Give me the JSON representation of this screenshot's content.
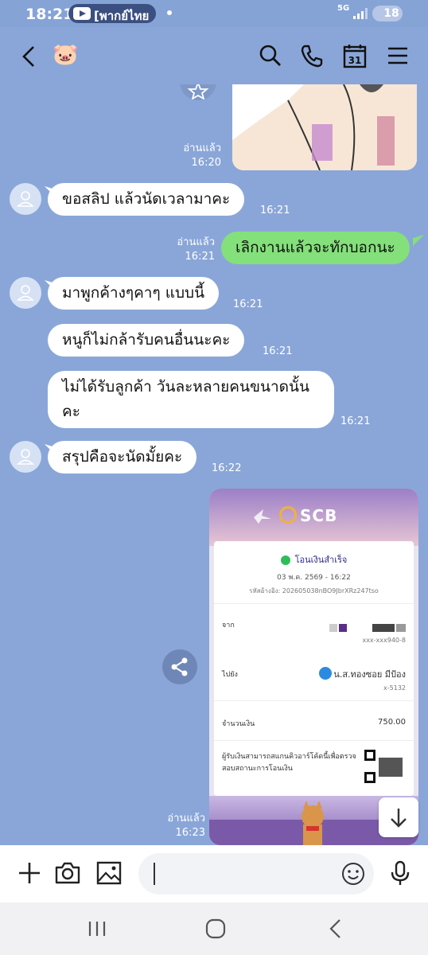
{
  "status_bar": {
    "time": "18:21",
    "pill_text": "[พากย์ไทย",
    "network": "5G",
    "battery": "18"
  },
  "header": {
    "contact_emoji": "🐷",
    "icons": [
      "back-icon",
      "search-icon",
      "call-icon",
      "calendar-icon",
      "menu-icon"
    ],
    "calendar_day": "31"
  },
  "chat": {
    "sticker_meta": {
      "read": "อ่านแล้ว",
      "time": "16:20"
    },
    "messages": [
      {
        "side": "in",
        "text": "ขอสลิป แล้วนัดเวลามาคะ",
        "time": "16:21"
      },
      {
        "side": "out",
        "read": "อ่านแล้ว",
        "text": "เลิกงานแล้วจะทักบอกนะ",
        "time": "16:21"
      },
      {
        "side": "in",
        "text": "มาพูกค้างๆคาๆ แบบนี้",
        "time": "16:21"
      },
      {
        "side": "in",
        "text": "หนูก็ไม่กล้ารับคนอื่นนะคะ",
        "time": "16:21"
      },
      {
        "side": "in",
        "text": "ไม่ได้รับลูกค้า วันละหลายคนขนาดนั้นคะ",
        "time": "16:21"
      },
      {
        "side": "in",
        "text": "สรุปคือจะนัดมั้ยคะ",
        "time": "16:22"
      }
    ],
    "slip_meta": {
      "read": "อ่านแล้ว",
      "time": "16:23"
    }
  },
  "slip": {
    "brand": "SCB",
    "status": "โอนเงินสำเร็จ",
    "date": "03 พ.ค. 2569 - 16:22",
    "ref_label": "รหัสอ้างอิง:",
    "ref": "202605038nBO9JbrXRz247tso",
    "from_label": "จาก",
    "from_account": "xxx-xxx940-8",
    "to_label": "ไปยัง",
    "to_name": "น.ส.ทองซอย มีป้อง",
    "to_account": "x-5132",
    "amount_label": "จำนวนเงิน",
    "amount": "750.00",
    "note": "ผู้รับเงินสามารถสแกนคิวอาร์โค้ดนี้เพื่อตรวจสอบสถานะการโอนเงิน"
  },
  "input_bar": {
    "placeholder": ""
  },
  "colors": {
    "background": "#8aa6d8",
    "outgoing_bubble": "#84e07a",
    "incoming_bubble": "#ffffff"
  }
}
